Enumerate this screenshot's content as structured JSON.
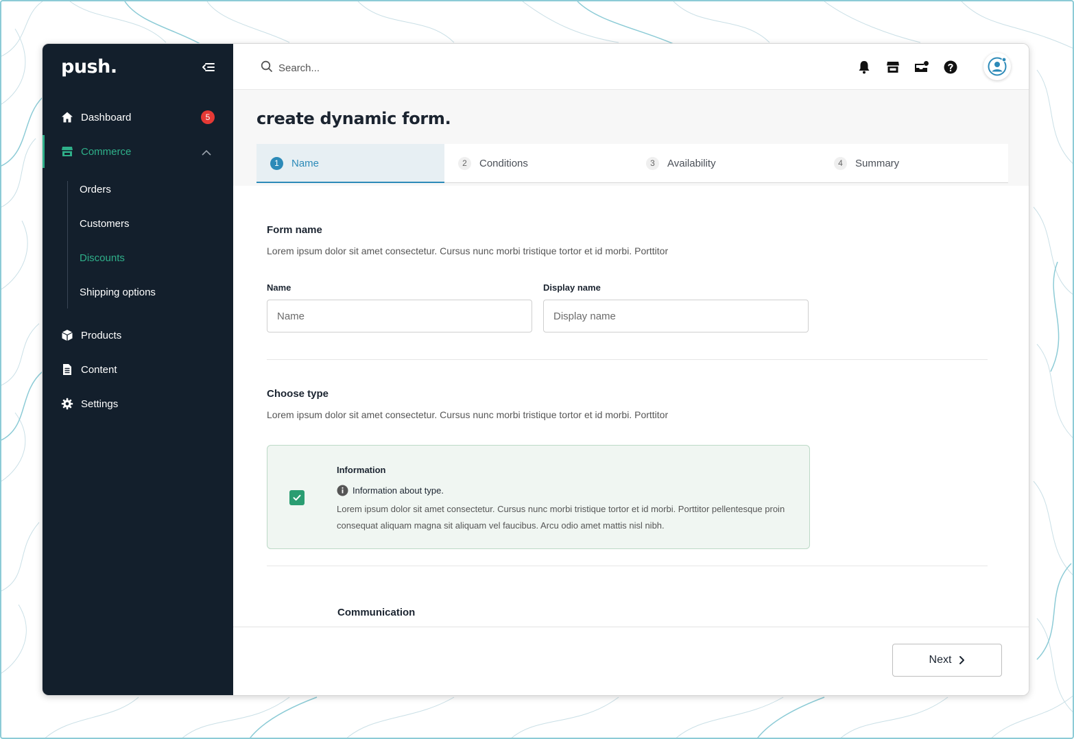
{
  "brand": {
    "logo": "push."
  },
  "sidebar": {
    "items": [
      {
        "label": "Dashboard",
        "icon": "home-icon",
        "badge": "5"
      },
      {
        "label": "Commerce",
        "icon": "store-icon",
        "expanded": true
      },
      {
        "label": "Products",
        "icon": "box-icon"
      },
      {
        "label": "Content",
        "icon": "document-icon"
      },
      {
        "label": "Settings",
        "icon": "gear-icon"
      }
    ],
    "commerce_sub": [
      "Orders",
      "Customers",
      "Discounts",
      "Shipping options"
    ],
    "active_sub": "Discounts"
  },
  "topbar": {
    "search_placeholder": "Search...",
    "icons": [
      "bell-icon",
      "store-icon",
      "inbox-icon",
      "help-icon",
      "user-avatar-icon"
    ]
  },
  "page": {
    "title": "create dynamic form.",
    "tabs": [
      {
        "num": "1",
        "label": "Name"
      },
      {
        "num": "2",
        "label": "Conditions"
      },
      {
        "num": "3",
        "label": "Availability"
      },
      {
        "num": "4",
        "label": "Summary"
      }
    ],
    "active_tab": 0
  },
  "form_name": {
    "title": "Form name",
    "description": "Lorem ipsum dolor sit amet consectetur. Cursus nunc morbi tristique tortor et id morbi. Porttitor",
    "name_label": "Name",
    "name_placeholder": "Name",
    "display_label": "Display name",
    "display_placeholder": "Display name"
  },
  "choose_type": {
    "title": "Choose type",
    "description": "Lorem ipsum dolor sit amet consectetur. Cursus nunc morbi tristique tortor et id morbi. Porttitor",
    "card": {
      "title": "Information",
      "checked": true,
      "info": "Information about type.",
      "description": "Lorem ipsum dolor sit amet consectetur. Cursus nunc morbi tristique tortor et id morbi. Porttitor pellentesque proin consequat aliquam magna sit aliquam vel faucibus. Arcu odio amet mattis nisl nibh."
    },
    "next_option_title": "Communication"
  },
  "footer": {
    "next_label": "Next"
  },
  "colors": {
    "sidebar_bg": "#131f2c",
    "accent_green": "#2fb08a",
    "accent_blue": "#2c8ab8",
    "badge_red": "#e53935",
    "card_bg": "#f0f6f2"
  }
}
